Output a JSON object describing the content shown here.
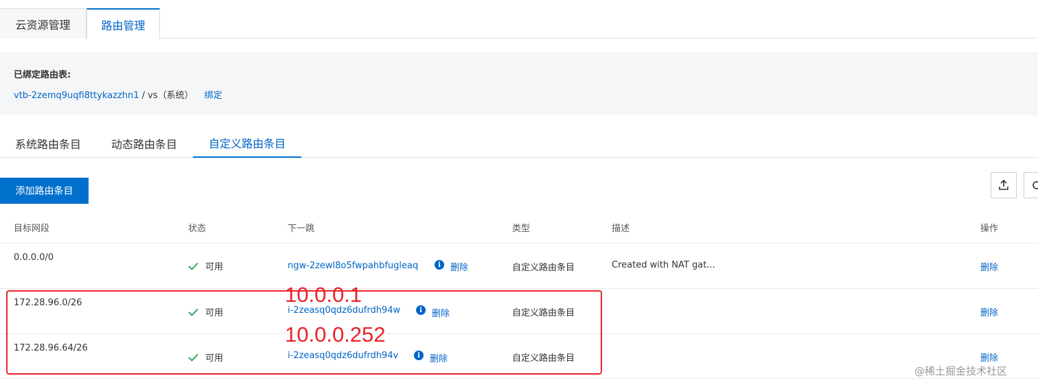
{
  "top_tabs": [
    "云资源管理",
    "路由管理"
  ],
  "bound": {
    "label": "已绑定路由表:",
    "table_id": "vtb-2zemq9uqfi8ttykazzhn1",
    "table_suffix": " / vs（系统）",
    "bind_link": "绑定"
  },
  "sub_tabs": [
    "系统路由条目",
    "动态路由条目",
    "自定义路由条目"
  ],
  "toolbar": {
    "add_button": "添加路由条目",
    "export_icon": "export-icon",
    "refresh_icon": "refresh-icon"
  },
  "table": {
    "headers": [
      "目标网段",
      "状态",
      "下一跳",
      "类型",
      "描述",
      "操作"
    ],
    "rows": [
      {
        "cidr": "0.0.0.0/0",
        "status": "可用",
        "next_hop": "ngw-2zewl8o5fwpahbfugleaq",
        "delete_inline": "删除",
        "type": "自定义路由条目",
        "desc": "Created with NAT gat...",
        "action": "删除"
      },
      {
        "cidr": "172.28.96.0/26",
        "status": "可用",
        "next_hop": "i-2zeasq0qdz6dufrdh94w",
        "delete_inline": "删除",
        "type": "自定义路由条目",
        "desc": "",
        "action": "删除"
      },
      {
        "cidr": "172.28.96.64/26",
        "status": "可用",
        "next_hop": "i-2zeasq0qdz6dufrdh94v",
        "delete_inline": "删除",
        "type": "自定义路由条目",
        "desc": "",
        "action": "删除"
      }
    ]
  },
  "annotations": [
    "10.0.0.1",
    "10.0.0.252"
  ],
  "watermark": "@稀土掘金技术社区",
  "colors": {
    "accent": "#0064c8",
    "primary_button": "#0070cc",
    "success": "#1aa34a",
    "annotation": "#e8232a"
  }
}
